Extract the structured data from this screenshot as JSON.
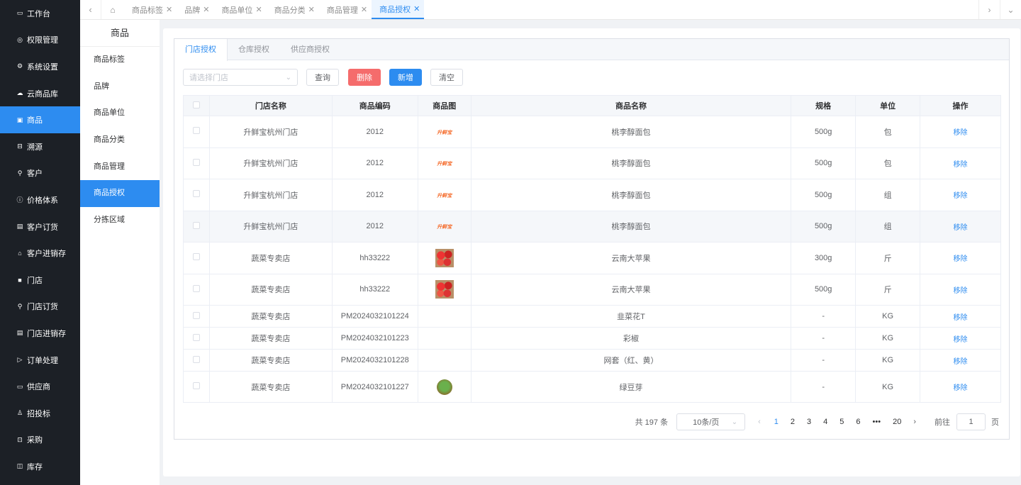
{
  "sidebar": {
    "items": [
      {
        "label": "工作台",
        "icon": "monitor-icon",
        "glyph": "▭"
      },
      {
        "label": "权限管理",
        "icon": "shield-icon",
        "glyph": "◎"
      },
      {
        "label": "系统设置",
        "icon": "gear-icon",
        "glyph": "⚙"
      },
      {
        "label": "云商品库",
        "icon": "cloud-icon",
        "glyph": "☁"
      },
      {
        "label": "商品",
        "icon": "goods-icon",
        "glyph": "▣",
        "active": true
      },
      {
        "label": "溯源",
        "icon": "trace-icon",
        "glyph": "⊟"
      },
      {
        "label": "客户",
        "icon": "customer-icon",
        "glyph": "⚲"
      },
      {
        "label": "价格体系",
        "icon": "price-icon",
        "glyph": "ⓘ"
      },
      {
        "label": "客户订货",
        "icon": "order-doc-icon",
        "glyph": "▤"
      },
      {
        "label": "客户进销存",
        "icon": "warehouse-icon",
        "glyph": "⌂"
      },
      {
        "label": "门店",
        "icon": "store-icon",
        "glyph": "■"
      },
      {
        "label": "门店订货",
        "icon": "store-order-icon",
        "glyph": "⚲"
      },
      {
        "label": "门店进销存",
        "icon": "store-stock-icon",
        "glyph": "▤"
      },
      {
        "label": "订单处理",
        "icon": "send-icon",
        "glyph": "▷"
      },
      {
        "label": "供应商",
        "icon": "supplier-icon",
        "glyph": "▭"
      },
      {
        "label": "招投标",
        "icon": "user-icon",
        "glyph": "♙"
      },
      {
        "label": "采购",
        "icon": "purchase-icon",
        "glyph": "⊡"
      },
      {
        "label": "库存",
        "icon": "inventory-icon",
        "glyph": "◫"
      }
    ]
  },
  "subnav": {
    "title": "商品",
    "items": [
      {
        "label": "商品标签"
      },
      {
        "label": "品牌"
      },
      {
        "label": "商品单位"
      },
      {
        "label": "商品分类"
      },
      {
        "label": "商品管理"
      },
      {
        "label": "商品授权",
        "active": true
      },
      {
        "label": "分拣区域"
      }
    ]
  },
  "tabbar": {
    "tabs": [
      {
        "label": "商品标签"
      },
      {
        "label": "品牌"
      },
      {
        "label": "商品单位"
      },
      {
        "label": "商品分类"
      },
      {
        "label": "商品管理"
      },
      {
        "label": "商品授权",
        "active": true
      }
    ],
    "close_glyph": "✕"
  },
  "panel": {
    "tabs": [
      {
        "label": "门店授权",
        "active": true
      },
      {
        "label": "仓库授权"
      },
      {
        "label": "供应商授权"
      }
    ],
    "toolbar": {
      "store_placeholder": "请选择门店",
      "query_label": "查询",
      "delete_label": "删除",
      "add_label": "新增",
      "clear_label": "清空"
    },
    "table": {
      "headers": [
        "门店名称",
        "商品编码",
        "商品图",
        "商品名称",
        "规格",
        "单位",
        "操作"
      ],
      "rows": [
        {
          "store": "升鲜宝杭州门店",
          "code": "2012",
          "image": "logo",
          "name": "桃李醇面包",
          "spec": "500g",
          "unit": "包",
          "action": "移除"
        },
        {
          "store": "升鲜宝杭州门店",
          "code": "2012",
          "image": "logo",
          "name": "桃李醇面包",
          "spec": "500g",
          "unit": "包",
          "action": "移除"
        },
        {
          "store": "升鲜宝杭州门店",
          "code": "2012",
          "image": "logo",
          "name": "桃李醇面包",
          "spec": "500g",
          "unit": "组",
          "action": "移除"
        },
        {
          "store": "升鲜宝杭州门店",
          "code": "2012",
          "image": "logo",
          "name": "桃李醇面包",
          "spec": "500g",
          "unit": "组",
          "action": "移除",
          "highlight": true
        },
        {
          "store": "蔬菜专卖店",
          "code": "hh33222",
          "image": "apple",
          "name": "云南大苹果",
          "spec": "300g",
          "unit": "斤",
          "action": "移除"
        },
        {
          "store": "蔬菜专卖店",
          "code": "hh33222",
          "image": "apple",
          "name": "云南大苹果",
          "spec": "500g",
          "unit": "斤",
          "action": "移除"
        },
        {
          "store": "蔬菜专卖店",
          "code": "PM2024032101224",
          "image": "",
          "name": "韭菜花T",
          "spec": "-",
          "unit": "KG",
          "action": "移除"
        },
        {
          "store": "蔬菜专卖店",
          "code": "PM2024032101223",
          "image": "",
          "name": "彩椒",
          "spec": "-",
          "unit": "KG",
          "action": "移除"
        },
        {
          "store": "蔬菜专卖店",
          "code": "PM2024032101228",
          "image": "",
          "name": "网套（红、黄）",
          "spec": "-",
          "unit": "KG",
          "action": "移除"
        },
        {
          "store": "蔬菜专卖店",
          "code": "PM2024032101227",
          "image": "sprout",
          "name": "绿豆芽",
          "spec": "-",
          "unit": "KG",
          "action": "移除"
        }
      ],
      "logo_text": "升鲜宝"
    },
    "pagination": {
      "total_text": "共 197 条",
      "page_size": "10条/页",
      "pages": [
        "1",
        "2",
        "3",
        "4",
        "5",
        "6",
        "•••",
        "20"
      ],
      "current": "1",
      "goto_label": "前往",
      "goto_value": "1",
      "page_unit": "页"
    }
  },
  "colors": {
    "accent": "#2d8cf0",
    "danger": "#f56c6c",
    "sidebar_bg": "#1c2026"
  }
}
